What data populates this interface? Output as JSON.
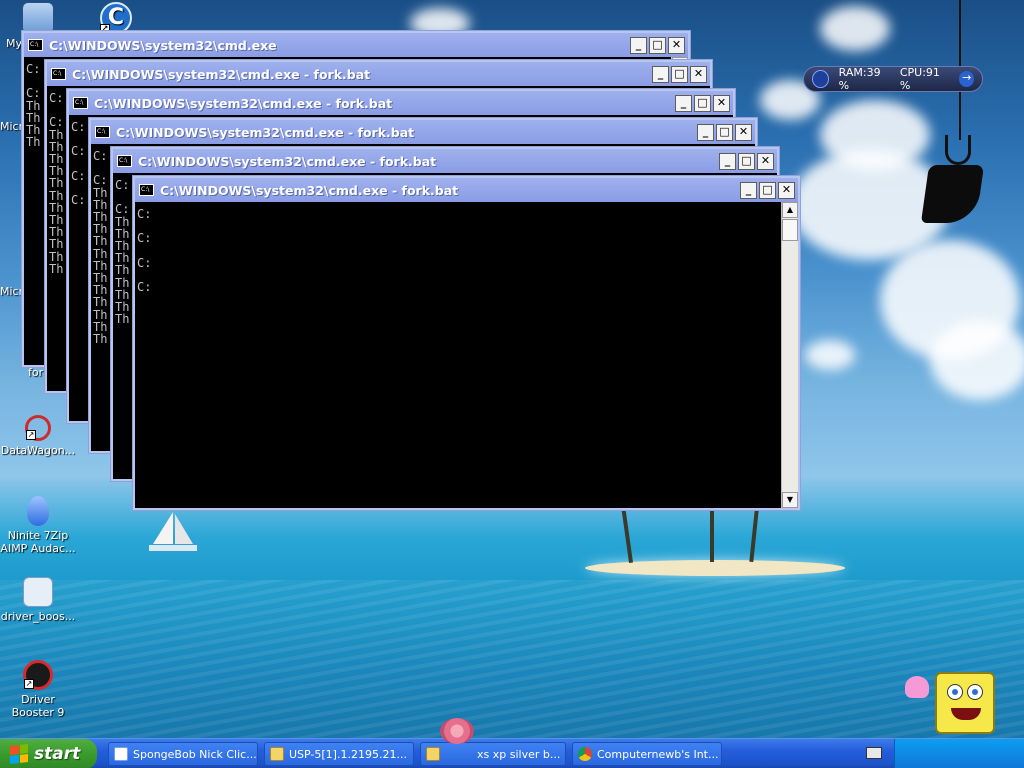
{
  "desktop": {
    "icons": [
      {
        "label": "My",
        "icon": "computer-icon"
      },
      {
        "label": "",
        "icon": "ccleaner-icon"
      },
      {
        "label": "Micr...",
        "icon": "microsoft-icon"
      },
      {
        "label": "Micr...",
        "icon": "microsoft-icon-2"
      },
      {
        "label": "for",
        "icon": "batch-file-icon"
      },
      {
        "label": "DataWagon...",
        "icon": "datawagon-icon"
      },
      {
        "label": "Ninite 7Zip AIMP Audac...",
        "icon": "ninite-icon"
      },
      {
        "label": "driver_boos...",
        "icon": "driver-booster-installer-icon"
      },
      {
        "label": "Driver Booster 9",
        "icon": "driver-booster-icon"
      }
    ],
    "colors": {
      "sky": "#2a6fb0",
      "sea": "#1796c8",
      "sand": "#f1e7c4"
    }
  },
  "gadget": {
    "ram": "RAM:39 %",
    "cpu": "CPU:91 %"
  },
  "windows": [
    {
      "title": "C:\\WINDOWS\\system32\\cmd.exe",
      "lines": [
        "C:",
        "",
        "C:",
        "Th",
        "Th",
        "Th",
        "Th"
      ]
    },
    {
      "title": "C:\\WINDOWS\\system32\\cmd.exe - fork.bat",
      "lines": [
        "C:",
        "",
        "C:",
        "Th",
        "Th",
        "Th",
        "Th",
        "Th",
        "Th",
        "Th",
        "Th",
        "Th",
        "Th",
        "Th",
        "Th"
      ]
    },
    {
      "title": "C:\\WINDOWS\\system32\\cmd.exe - fork.bat",
      "lines": [
        "C:",
        "",
        "C:",
        "",
        "C:",
        "",
        "C:"
      ]
    },
    {
      "title": "C:\\WINDOWS\\system32\\cmd.exe - fork.bat",
      "lines": [
        "C:",
        "",
        "C:",
        "Th",
        "Th",
        "Th",
        "Th",
        "Th",
        "Th",
        "Th",
        "Th",
        "Th",
        "Th",
        "Th",
        "Th",
        "Th"
      ]
    },
    {
      "title": "C:\\WINDOWS\\system32\\cmd.exe - fork.bat",
      "lines": [
        "C:",
        "",
        "C:",
        "Th",
        "Th",
        "Th",
        "Th",
        "Th",
        "Th",
        "Th",
        "Th",
        "Th"
      ]
    },
    {
      "title": "C:\\WINDOWS\\system32\\cmd.exe - fork.bat",
      "lines": [
        "C:",
        "",
        "C:",
        "",
        "C:",
        "",
        "C:"
      ]
    }
  ],
  "taskbar": {
    "start_label": "start",
    "tasks": [
      {
        "label": "SpongeBob Nick Clic...",
        "icon": "window-icon"
      },
      {
        "label": "USP-5[1].1.2195.21...",
        "icon": "folder-icon"
      },
      {
        "label": "xs xp silver b...",
        "icon": "folder-icon"
      },
      {
        "label": "Computernewb's Int...",
        "icon": "chrome-icon"
      }
    ]
  }
}
